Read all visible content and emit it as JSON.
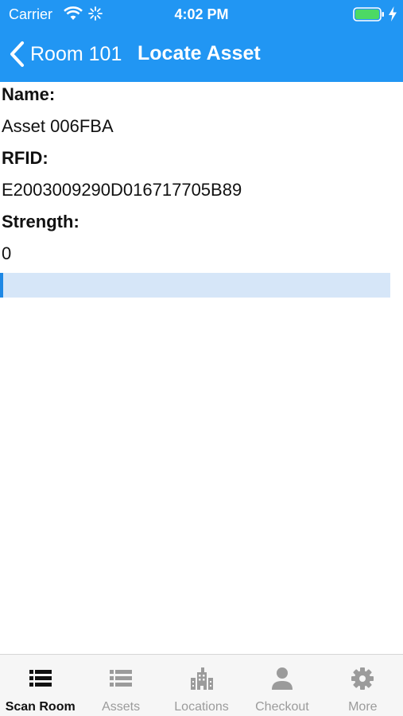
{
  "status_bar": {
    "carrier": "Carrier",
    "time": "4:02 PM",
    "battery_color": "#4cd964"
  },
  "nav": {
    "back_label": "Room 101",
    "title": "Locate Asset"
  },
  "asset": {
    "name_label": "Name:",
    "name_value": "Asset 006FBA",
    "rfid_label": "RFID:",
    "rfid_value": "E2003009290D016717705B89",
    "strength_label": "Strength:",
    "strength_value": "0",
    "strength_fraction": 0
  },
  "tabs": [
    {
      "label": "Scan Room",
      "icon": "list-icon",
      "active": true
    },
    {
      "label": "Assets",
      "icon": "list-icon",
      "active": false
    },
    {
      "label": "Locations",
      "icon": "building-icon",
      "active": false
    },
    {
      "label": "Checkout",
      "icon": "person-icon",
      "active": false
    },
    {
      "label": "More",
      "icon": "gear-icon",
      "active": false
    }
  ],
  "colors": {
    "header_bg": "#2196f3",
    "progress_track": "#d6e6f8",
    "progress_fill": "#1e88e5",
    "tab_active": "#111111",
    "tab_inactive": "#9b9b9b"
  }
}
